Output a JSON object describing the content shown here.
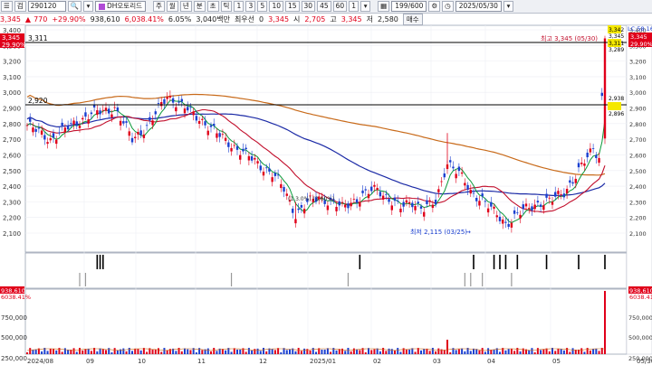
{
  "toolbar": {
    "code_prefix": "검",
    "code": "290120",
    "name": "DH오토리드",
    "buttons": [
      "주",
      "월",
      "년",
      "분",
      "초",
      "틱",
      "1",
      "3",
      "5",
      "10",
      "15",
      "30",
      "45",
      "60",
      "1"
    ],
    "count": "199/600",
    "date": "2025/05/30"
  },
  "quote": {
    "price": "3,345",
    "change": "770",
    "change_pct": "+29.90%",
    "volume": "938,610",
    "volume_ratio": "6,038.41%",
    "turnover_ratio": "6.05%",
    "amount": "3,040백만",
    "amount_label": "최우선",
    "zero": "0",
    "open_val": "3,345",
    "open_label": "시",
    "high_label": "고",
    "open2": "2,705",
    "high_val": "3,345",
    "low_label": "저",
    "low_val": "2,580",
    "buy_button": "매수"
  },
  "price_panel": {
    "corner_price": "3,345",
    "corner_change": "770",
    "corner_pct": "29.90%",
    "level_top_label": "3,311",
    "level_mid_label": "2,920",
    "high_annotation": "최고 3,345 (05/30)",
    "low_annotation": "최저 2,115 (03/25)",
    "mid_annotation": "(1,3.0%) (3.60%)",
    "right_tag_top": "3,342",
    "right_tag_high": "3,345",
    "right_tag_2": "3,311",
    "right_tag_3": "3,289",
    "right_tag_4": "2,938",
    "right_tag_5": "2,896",
    "lc_label": "LC:58.16",
    "y_ticks": [
      "3,400",
      "3,300",
      "3,200",
      "3,100",
      "3,000",
      "2,900",
      "2,800",
      "2,700",
      "2,600",
      "2,500",
      "2,400",
      "2,300",
      "2,200",
      "2,100"
    ]
  },
  "volume_panel": {
    "corner_value": "938,610",
    "corner_pct": "6038.41%",
    "right_value": "938,610",
    "right_pct": "6038.41%",
    "y_ticks": [
      "750,000",
      "500,000",
      "250,000"
    ],
    "right_ticks": [
      "750,000",
      "500,000",
      "250,000"
    ]
  },
  "x_axis": {
    "labels": [
      "2024/08",
      "09",
      "10",
      "11",
      "12",
      "2025/01",
      "02",
      "03",
      "04",
      "05",
      "05/30"
    ]
  },
  "colors": {
    "up": "#e0001a",
    "down": "#1a3fd0",
    "ma5": "#0a9a3a",
    "ma20": "#c20f2c",
    "ma60": "#1b2aa6",
    "ma120": "#c86a1a"
  }
}
